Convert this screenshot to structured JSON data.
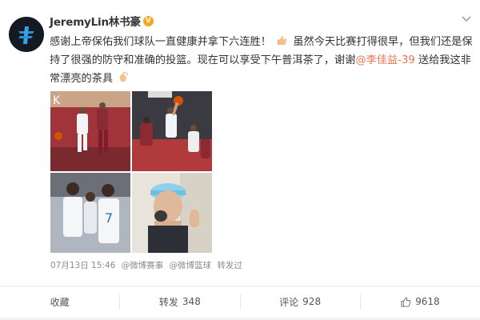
{
  "post": {
    "username": "JeremyLin林书豪",
    "verified_badge": "V",
    "text_part1": "感谢上帝保佑我们球队一直健康并拿下六连胜！",
    "text_part2": "虽然今天比赛打得很早，但我们还是保持了很强的防守和准确的投篮。现在可以享受下午普洱茶了，谢谢",
    "mention": "@李佳益-39",
    "text_part3": " 送给我这非常漂亮的茶具",
    "emoji_1": "thumbs-up-emoji",
    "emoji_2": "clapping-hands-emoji",
    "photos": [
      {
        "name": "photo-basketball-drive"
      },
      {
        "name": "photo-basketball-layup"
      },
      {
        "name": "photo-team-huddle"
      },
      {
        "name": "photo-tea-selfie"
      }
    ],
    "timestamp": "07月13日 15:46",
    "source_prefix": "@微博赛事",
    "source_middle": "@微博篮球",
    "source_suffix": "转发过"
  },
  "actions": {
    "favorite_label": "收藏",
    "repost_label": "转发",
    "repost_count": "348",
    "comment_label": "评论",
    "comment_count": "928",
    "like_count": "9618"
  },
  "colors": {
    "mention": "#eb7350",
    "verified": "#f6a524",
    "meta": "#8c8c8c"
  }
}
